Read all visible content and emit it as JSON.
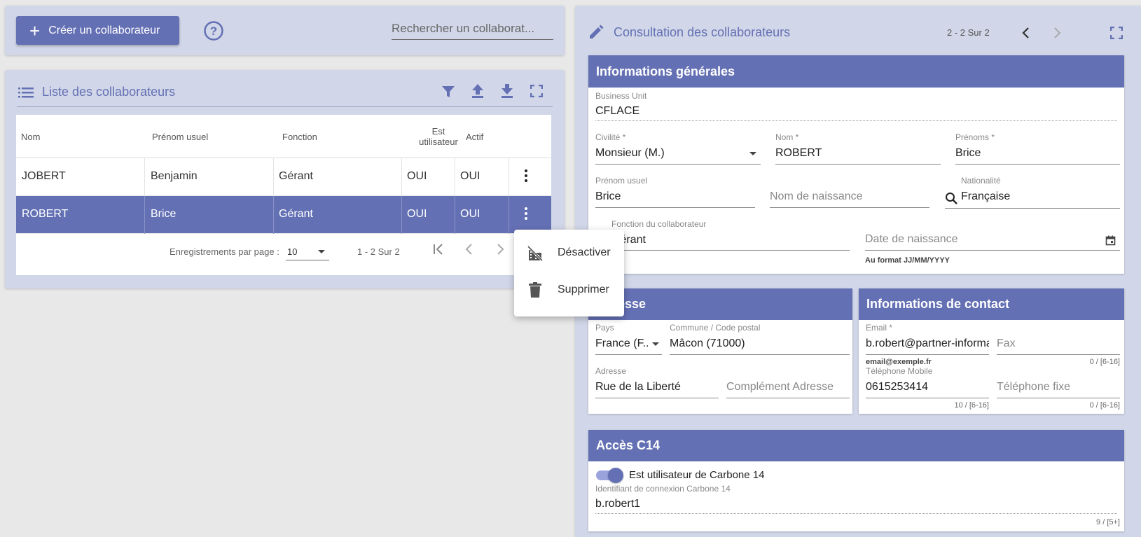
{
  "toolbar": {
    "create_label": "Créer un collaborateur",
    "search_placeholder": "Rechercher un collaborat..."
  },
  "list": {
    "title": "Liste des collaborateurs",
    "columns": [
      "Nom",
      "Prénom usuel",
      "Fonction",
      "Est utilisateur",
      "Actif"
    ],
    "rows": [
      {
        "nom": "JOBERT",
        "prenom": "Benjamin",
        "fonction": "Gérant",
        "est_utilisateur": "OUI",
        "actif": "OUI",
        "selected": false
      },
      {
        "nom": "ROBERT",
        "prenom": "Brice",
        "fonction": "Gérant",
        "est_utilisateur": "OUI",
        "actif": "OUI",
        "selected": true
      }
    ],
    "pagination": {
      "per_page_label": "Enregistrements par page :",
      "per_page_value": "10",
      "range": "1 - 2 Sur 2"
    }
  },
  "context_menu": {
    "items": [
      "Désactiver",
      "Supprimer"
    ]
  },
  "detail": {
    "title": "Consultation des collaborateurs",
    "range": "2 - 2 Sur 2",
    "general": {
      "header": "Informations générales",
      "business_unit_label": "Business Unit",
      "business_unit": "CFLACE",
      "civilite_label": "Civilité *",
      "civilite": "Monsieur (M.)",
      "nom_label": "Nom *",
      "nom": "ROBERT",
      "prenoms_label": "Prénoms *",
      "prenoms": "Brice",
      "prenom_usuel_label": "Prénom usuel",
      "prenom_usuel": "Brice",
      "nom_naissance_placeholder": "Nom de naissance",
      "nationalite_label": "Nationalité",
      "nationalite": "Française",
      "fonction_label": "Fonction du collaborateur",
      "fonction": "Gérant",
      "date_naissance_placeholder": "Date de naissance",
      "date_hint": "Au format JJ/MM/YYYY"
    },
    "adresse": {
      "header": "Adresse",
      "pays_label": "Pays",
      "pays": "France (F...",
      "commune_label": "Commune / Code postal",
      "commune": "Mâcon (71000)",
      "adresse_label": "Adresse",
      "adresse": "Rue de la Liberté",
      "complement_placeholder": "Complément Adresse"
    },
    "contact": {
      "header": "Informations de contact",
      "email_label": "Email *",
      "email": "b.robert@partner-informa",
      "email_hint": "email@exemple.fr",
      "fax_placeholder": "Fax",
      "fax_counter": "0 / [6-16]",
      "mobile_label": "Téléphone Mobile",
      "mobile": "0615253414",
      "mobile_counter": "10 / [6-16]",
      "fixe_placeholder": "Téléphone fixe",
      "fixe_counter": "0 / [6-16]"
    },
    "acces": {
      "header": "Accès C14",
      "toggle_label": "Est utilisateur de Carbone 14",
      "toggle_on": true,
      "identifiant_label": "Identifiant de connexion Carbone 14",
      "identifiant": "b.robert1",
      "identifiant_counter": "9 / [5+]"
    }
  },
  "colors": {
    "accent": "#6470b4",
    "panel": "#d1d7e8",
    "background": "#e8e8e8"
  }
}
